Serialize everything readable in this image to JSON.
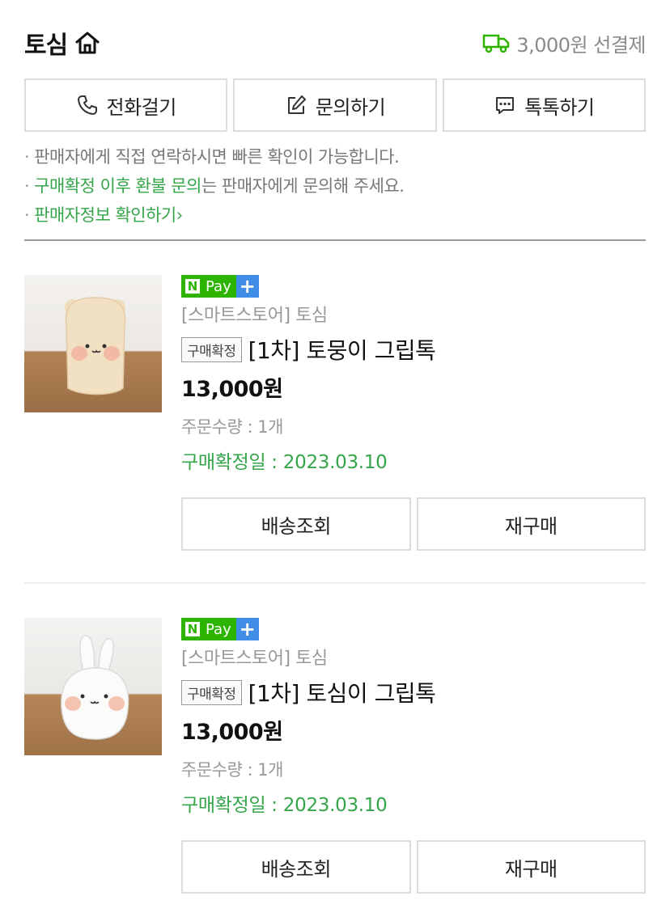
{
  "header": {
    "store_name": "토심",
    "shipping_text": "3,000원 선결제"
  },
  "contact": {
    "call_label": "전화걸기",
    "inquiry_label": "문의하기",
    "talk_label": "톡톡하기"
  },
  "notice": {
    "line1": "판매자에게 직접 연락하시면 빠른 확인이 가능합니다.",
    "line2_highlight": "구매확정 이후 환불 문의",
    "line2_rest": "는 판매자에게 문의해 주세요.",
    "line3_link": "판매자정보 확인하기",
    "line3_arrow": "›"
  },
  "npay": {
    "n": "N",
    "pay": "Pay",
    "plus": "+"
  },
  "orders": [
    {
      "store_label": "[스마트스토어] 토심",
      "status_chip": "구매확정",
      "product_name": "[1차] 토뭉이 그립톡",
      "price": "13,000원",
      "quantity": "주문수량 : 1개",
      "confirm_date": "구매확정일 : 2023.03.10",
      "track_label": "배송조회",
      "rebuy_label": "재구매"
    },
    {
      "store_label": "[스마트스토어] 토심",
      "status_chip": "구매확정",
      "product_name": "[1차] 토심이 그립톡",
      "price": "13,000원",
      "quantity": "주문수량 : 1개",
      "confirm_date": "구매확정일 : 2023.03.10",
      "track_label": "배송조회",
      "rebuy_label": "재구매"
    }
  ],
  "colors": {
    "green": "#2db400",
    "green_text": "#35a54a",
    "npay_plus": "#3f8de6",
    "border": "#dcdcdc"
  }
}
